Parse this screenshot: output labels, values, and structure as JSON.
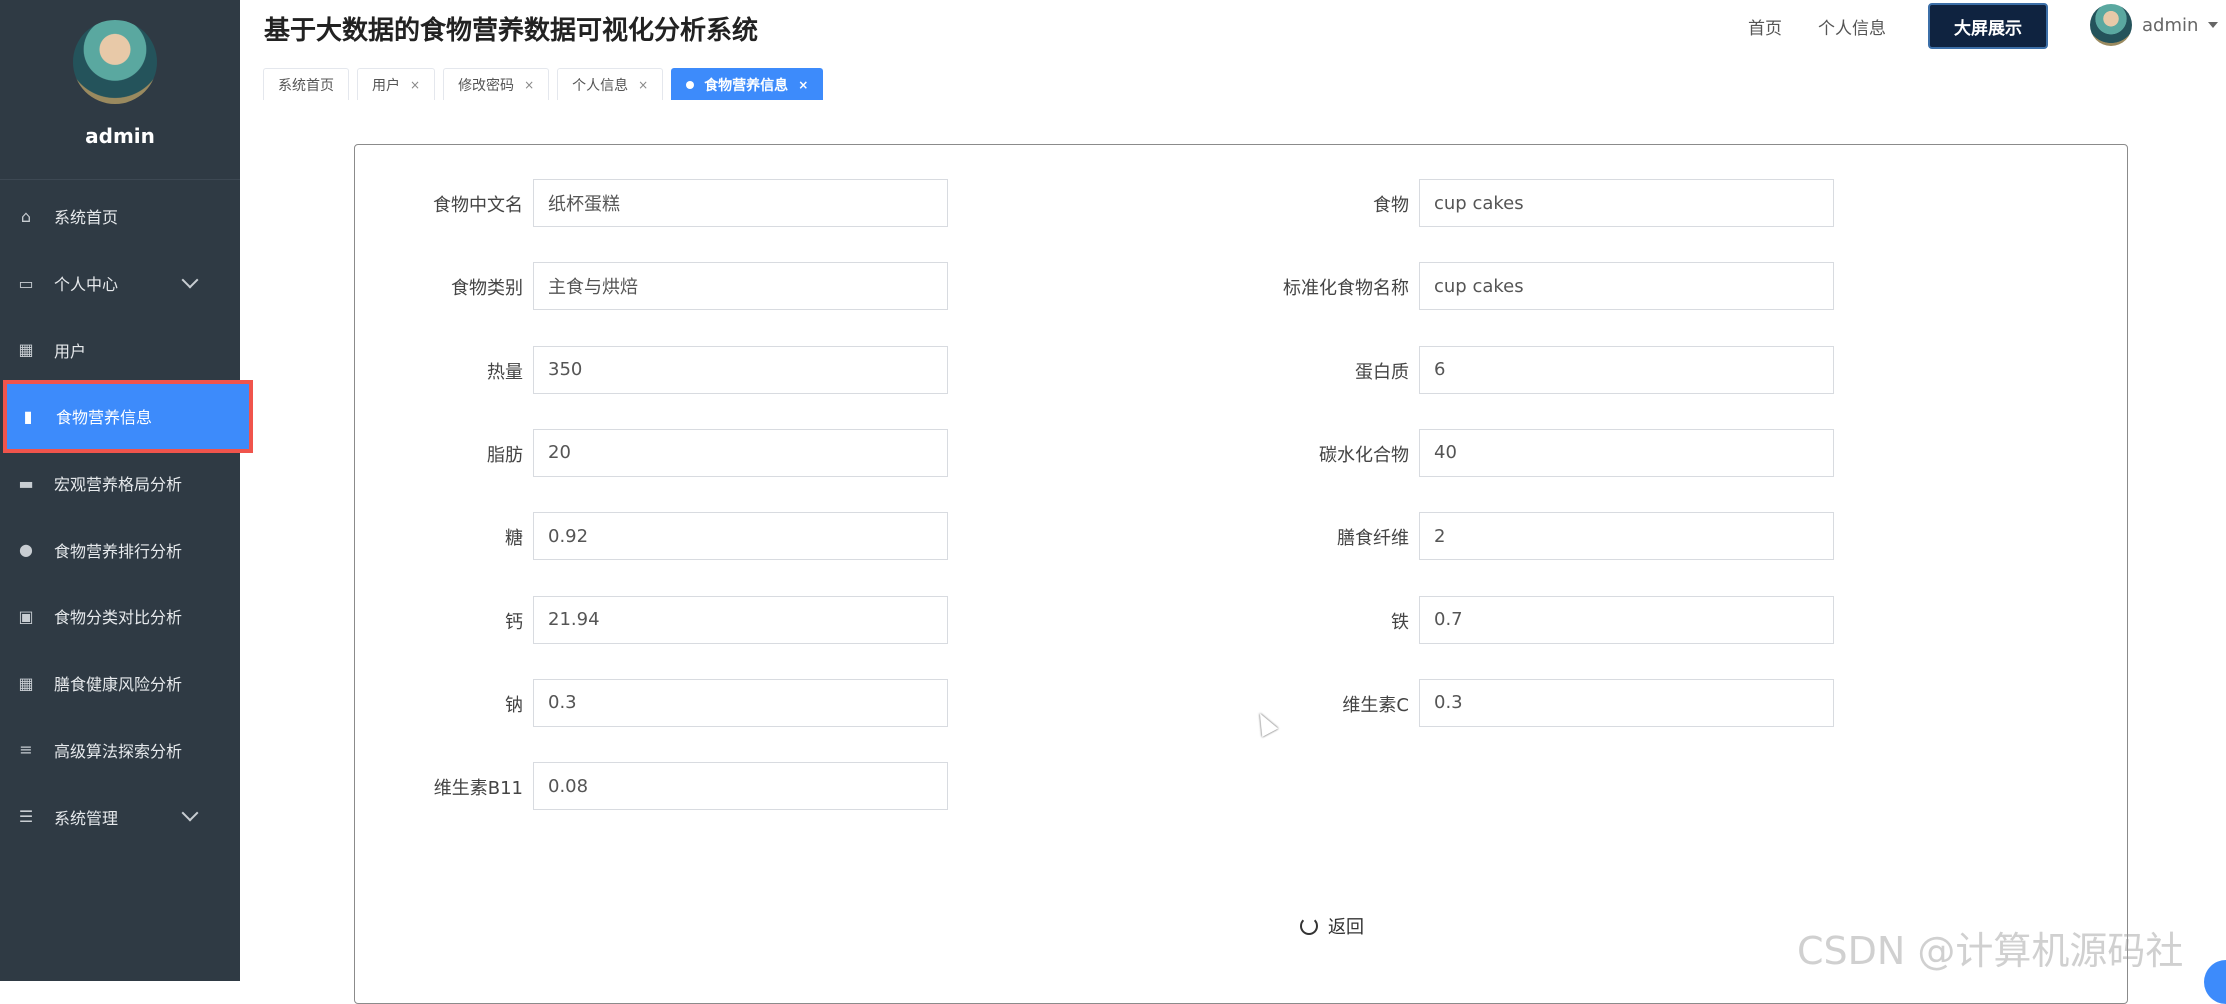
{
  "app": {
    "title": "基于大数据的食物营养数据可视化分析系统"
  },
  "sidebar": {
    "username": "admin",
    "items": [
      {
        "label": "系统首页",
        "icon": "home-icon",
        "glyph": "⌂"
      },
      {
        "label": "个人中心",
        "icon": "wallet-icon",
        "glyph": "▭",
        "expandable": true
      },
      {
        "label": "用户",
        "icon": "grid-icon",
        "glyph": "▦"
      },
      {
        "label": "食物营养信息",
        "icon": "book-icon",
        "glyph": "▮",
        "active": true
      },
      {
        "label": "宏观营养格局分析",
        "icon": "printer-icon",
        "glyph": "▬"
      },
      {
        "label": "食物营养排行分析",
        "icon": "bulb-icon",
        "glyph": "●"
      },
      {
        "label": "食物分类对比分析",
        "icon": "clipboard-icon",
        "glyph": "▣"
      },
      {
        "label": "膳食健康风险分析",
        "icon": "grid-icon",
        "glyph": "▦"
      },
      {
        "label": "高级算法探索分析",
        "icon": "list-icon",
        "glyph": "≡"
      },
      {
        "label": "系统管理",
        "icon": "sliders-icon",
        "glyph": "☰",
        "expandable": true
      }
    ]
  },
  "header": {
    "links": [
      "首页",
      "个人信息"
    ],
    "big_screen": "大屏展示",
    "user": "admin"
  },
  "tabs": [
    {
      "label": "系统首页",
      "closable": false
    },
    {
      "label": "用户",
      "closable": true
    },
    {
      "label": "修改密码",
      "closable": true
    },
    {
      "label": "个人信息",
      "closable": true
    },
    {
      "label": "食物营养信息",
      "closable": true,
      "active": true
    }
  ],
  "form": {
    "left": [
      {
        "label": "食物中文名",
        "value": "纸杯蛋糕"
      },
      {
        "label": "食物类别",
        "value": "主食与烘焙"
      },
      {
        "label": "热量",
        "value": "350"
      },
      {
        "label": "脂肪",
        "value": "20"
      },
      {
        "label": "糖",
        "value": "0.92"
      },
      {
        "label": "钙",
        "value": "21.94"
      },
      {
        "label": "钠",
        "value": "0.3"
      },
      {
        "label": "维生素B11",
        "value": "0.08"
      }
    ],
    "right": [
      {
        "label": "食物",
        "value": "cup cakes"
      },
      {
        "label": "标准化食物名称",
        "value": "cup cakes"
      },
      {
        "label": "蛋白质",
        "value": "6"
      },
      {
        "label": "碳水化合物",
        "value": "40"
      },
      {
        "label": "膳食纤维",
        "value": "2"
      },
      {
        "label": "铁",
        "value": "0.7"
      },
      {
        "label": "维生素C",
        "value": "0.3"
      }
    ],
    "back_label": "返回"
  },
  "watermark": "CSDN @计算机源码社",
  "tab_close_glyph": "×"
}
